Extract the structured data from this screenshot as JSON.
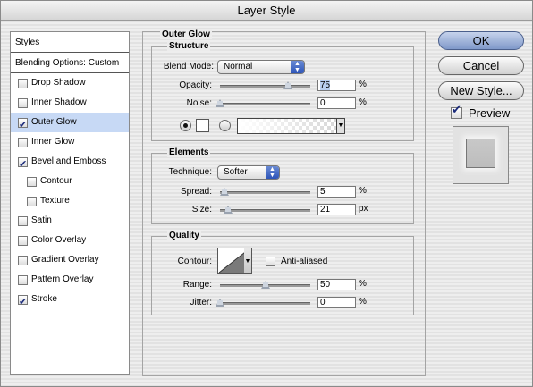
{
  "window": {
    "title": "Layer Style"
  },
  "sidebar": {
    "header": "Styles",
    "blending": "Blending Options: Custom",
    "items": [
      {
        "label": "Drop Shadow",
        "checked": false,
        "sub": false,
        "selected": false
      },
      {
        "label": "Inner Shadow",
        "checked": false,
        "sub": false,
        "selected": false
      },
      {
        "label": "Outer Glow",
        "checked": true,
        "sub": false,
        "selected": true
      },
      {
        "label": "Inner Glow",
        "checked": false,
        "sub": false,
        "selected": false
      },
      {
        "label": "Bevel and Emboss",
        "checked": true,
        "sub": false,
        "selected": false
      },
      {
        "label": "Contour",
        "checked": false,
        "sub": true,
        "selected": false
      },
      {
        "label": "Texture",
        "checked": false,
        "sub": true,
        "selected": false
      },
      {
        "label": "Satin",
        "checked": false,
        "sub": false,
        "selected": false
      },
      {
        "label": "Color Overlay",
        "checked": false,
        "sub": false,
        "selected": false
      },
      {
        "label": "Gradient Overlay",
        "checked": false,
        "sub": false,
        "selected": false
      },
      {
        "label": "Pattern Overlay",
        "checked": false,
        "sub": false,
        "selected": false
      },
      {
        "label": "Stroke",
        "checked": true,
        "sub": false,
        "selected": false
      }
    ]
  },
  "panel": {
    "title": "Outer Glow",
    "structure": {
      "title": "Structure",
      "blend_mode_label": "Blend Mode:",
      "blend_mode_value": "Normal",
      "opacity_label": "Opacity:",
      "opacity_value": "75",
      "opacity_unit": "%",
      "opacity_level": 0.75,
      "noise_label": "Noise:",
      "noise_value": "0",
      "noise_unit": "%",
      "noise_level": 0.0,
      "color_mode": "solid"
    },
    "elements": {
      "title": "Elements",
      "technique_label": "Technique:",
      "technique_value": "Softer",
      "spread_label": "Spread:",
      "spread_value": "5",
      "spread_unit": "%",
      "spread_level": 0.05,
      "size_label": "Size:",
      "size_value": "21",
      "size_unit": "px",
      "size_level": 0.085
    },
    "quality": {
      "title": "Quality",
      "contour_label": "Contour:",
      "anti_aliased_label": "Anti-aliased",
      "anti_aliased": false,
      "range_label": "Range:",
      "range_value": "50",
      "range_unit": "%",
      "range_level": 0.5,
      "jitter_label": "Jitter:",
      "jitter_value": "0",
      "jitter_unit": "%",
      "jitter_level": 0.0
    }
  },
  "buttons": {
    "ok": "OK",
    "cancel": "Cancel",
    "new_style": "New Style..."
  },
  "preview": {
    "label": "Preview",
    "checked": true
  }
}
